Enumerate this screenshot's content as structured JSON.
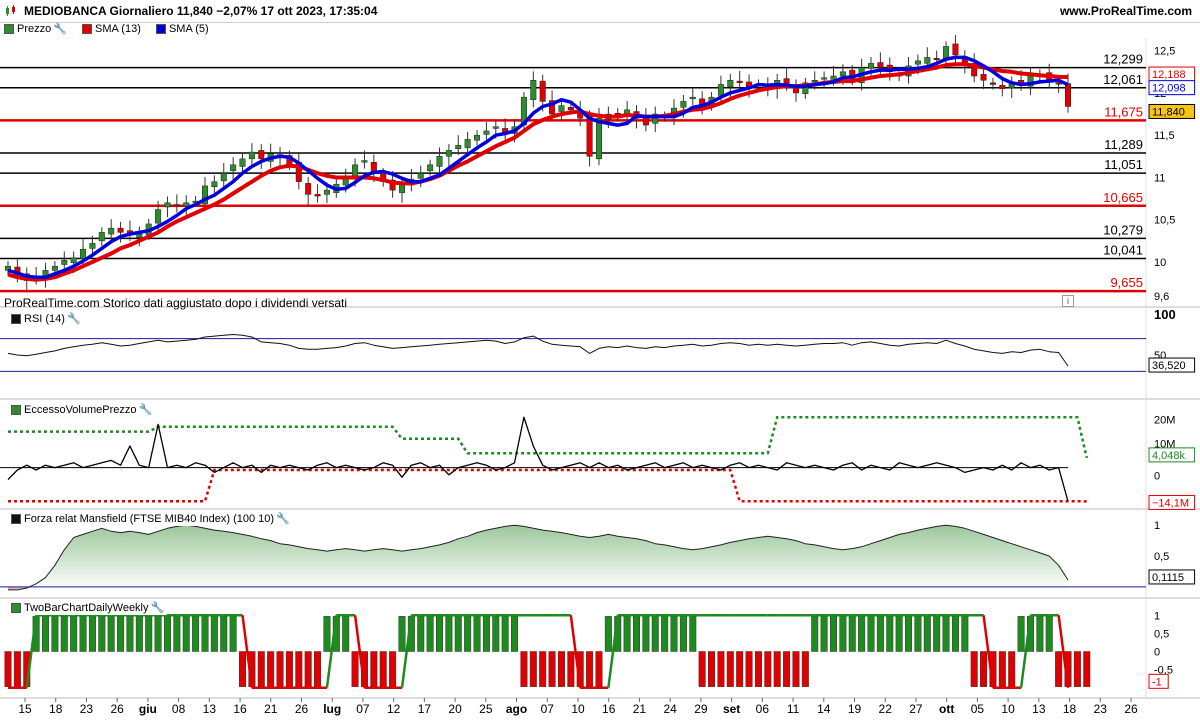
{
  "header": {
    "title": "MEDIOBANCA Giornaliero 11,840 −2,07% 17 ott 2023, 17:35:04",
    "site": "www.ProRealTime.com"
  },
  "price_panel": {
    "legend": [
      {
        "label": "Prezzo",
        "color": "#2e8b2e"
      },
      {
        "label": "SMA (13)",
        "color": "#e00000"
      },
      {
        "label": "SMA (5)",
        "color": "#0000dd"
      }
    ],
    "footer_note": "ProRealTime.com  Storico dati aggiustato dopo i dividendi versati",
    "info_icon": "i"
  },
  "panels": {
    "rsi": {
      "label": "RSI (14)",
      "value_tag": "36,520",
      "ticks": [
        "100",
        "50"
      ]
    },
    "volume": {
      "label": "EccessoVolumePrezzo",
      "tags": [
        "4,048k",
        "0",
        "−14,1M"
      ],
      "ticks": [
        "20M",
        "10M",
        "0"
      ]
    },
    "mansfield": {
      "label": "Forza relat Mansfield (FTSE MIB40 Index) (100 10)",
      "value_tag": "0,1115",
      "ticks": [
        "1",
        "0,5",
        "0"
      ]
    },
    "twobar": {
      "label": "TwoBarChartDailyWeekly",
      "value_tag": "-1",
      "ticks": [
        "1",
        "0,5",
        "0",
        "-0,5"
      ]
    }
  },
  "x_axis": {
    "labels": [
      "15",
      "18",
      "23",
      "26",
      "giu",
      "08",
      "13",
      "16",
      "21",
      "26",
      "lug",
      "07",
      "12",
      "17",
      "20",
      "25",
      "ago",
      "07",
      "10",
      "16",
      "21",
      "24",
      "29",
      "set",
      "06",
      "11",
      "14",
      "19",
      "22",
      "27",
      "ott",
      "05",
      "10",
      "13",
      "18",
      "23",
      "26"
    ],
    "bold": [
      "giu",
      "lug",
      "ago",
      "set",
      "ott"
    ]
  },
  "chart_data": [
    {
      "type": "candlestick",
      "title": "MEDIOBANCA Giornaliero",
      "ylim": [
        9.55,
        12.65
      ],
      "y_ticks": [
        "12,5",
        "12",
        "11,5",
        "11",
        "10,5",
        "10",
        "9,6"
      ],
      "price_tags": [
        {
          "label": "12,188",
          "series": "SMA (13)",
          "color": "#e00000"
        },
        {
          "label": "12,098",
          "series": "SMA (5)",
          "color": "#0000dd"
        },
        {
          "label": "11,840",
          "series": "Prezzo",
          "color": "#f5c518"
        }
      ],
      "levels": [
        {
          "value": 12.299,
          "label": "12,299",
          "color": "#000000"
        },
        {
          "value": 12.061,
          "label": "12,061",
          "color": "#000000"
        },
        {
          "value": 11.675,
          "label": "11,675",
          "color": "#e00000"
        },
        {
          "value": 11.289,
          "label": "11,289",
          "color": "#000000"
        },
        {
          "value": 11.051,
          "label": "11,051",
          "color": "#000000"
        },
        {
          "value": 10.665,
          "label": "10,665",
          "color": "#e00000"
        },
        {
          "value": 10.279,
          "label": "10,279",
          "color": "#000000"
        },
        {
          "value": 10.041,
          "label": "10,041",
          "color": "#000000"
        },
        {
          "value": 9.655,
          "label": "9,655",
          "color": "#e00000"
        }
      ],
      "close": [
        9.95,
        9.85,
        9.78,
        9.82,
        9.9,
        9.95,
        10.02,
        10.05,
        10.15,
        10.22,
        10.35,
        10.4,
        10.35,
        10.32,
        10.33,
        10.45,
        10.62,
        10.7,
        10.66,
        10.7,
        10.72,
        10.9,
        10.95,
        11.05,
        11.15,
        11.22,
        11.3,
        11.22,
        11.28,
        11.25,
        11.15,
        10.95,
        10.8,
        10.78,
        10.85,
        10.92,
        11.0,
        11.15,
        11.2,
        11.05,
        10.95,
        10.85,
        10.92,
        10.98,
        11.05,
        11.15,
        11.25,
        11.32,
        11.38,
        11.45,
        11.5,
        11.55,
        11.6,
        11.52,
        11.6,
        11.95,
        12.15,
        11.9,
        11.75,
        11.85,
        11.8,
        11.7,
        11.25,
        11.7,
        11.75,
        11.72,
        11.8,
        11.7,
        11.62,
        11.75,
        11.72,
        11.82,
        11.9,
        11.95,
        11.85,
        11.95,
        12.1,
        12.15,
        12.12,
        12.05,
        12.1,
        12.05,
        12.15,
        12.1,
        12.0,
        12.12,
        12.15,
        12.18,
        12.2,
        12.25,
        12.15,
        12.3,
        12.35,
        12.3,
        12.25,
        12.2,
        12.32,
        12.38,
        12.42,
        12.4,
        12.55,
        12.45,
        12.35,
        12.2,
        12.15,
        12.1,
        12.05,
        12.12,
        12.1,
        12.2,
        12.22,
        12.15,
        12.12,
        11.84
      ],
      "sma13": [
        9.85,
        9.82,
        9.8,
        9.79,
        9.8,
        9.82,
        9.86,
        9.9,
        9.95,
        10.0,
        10.05,
        10.1,
        10.16,
        10.2,
        10.25,
        10.3,
        10.35,
        10.42,
        10.48,
        10.53,
        10.58,
        10.63,
        10.68,
        10.74,
        10.81,
        10.88,
        10.95,
        11.02,
        11.08,
        11.12,
        11.14,
        11.13,
        11.09,
        11.05,
        11.02,
        11.0,
        11.0,
        11.0,
        11.0,
        10.99,
        10.97,
        10.94,
        10.93,
        10.93,
        10.95,
        10.98,
        11.02,
        11.08,
        11.14,
        11.19,
        11.25,
        11.31,
        11.37,
        11.42,
        11.47,
        11.55,
        11.63,
        11.68,
        11.72,
        11.75,
        11.77,
        11.78,
        11.75,
        11.73,
        11.72,
        11.72,
        11.74,
        11.73,
        11.72,
        11.72,
        11.73,
        11.75,
        11.78,
        11.8,
        11.81,
        11.84,
        11.88,
        11.93,
        11.97,
        12.0,
        12.03,
        12.05,
        12.07,
        12.08,
        12.08,
        12.09,
        12.1,
        12.12,
        12.13,
        12.14,
        12.14,
        12.16,
        12.18,
        12.2,
        12.21,
        12.22,
        12.24,
        12.26,
        12.28,
        12.3,
        12.33,
        12.34,
        12.34,
        12.32,
        12.3,
        12.28,
        12.26,
        12.25,
        12.23,
        12.22,
        12.21,
        12.2,
        12.19,
        12.188
      ],
      "sma5": [
        9.9,
        9.87,
        9.83,
        9.82,
        9.82,
        9.86,
        9.9,
        9.95,
        10.01,
        10.08,
        10.16,
        10.24,
        10.3,
        10.33,
        10.35,
        10.37,
        10.42,
        10.48,
        10.55,
        10.63,
        10.68,
        10.74,
        10.79,
        10.87,
        10.95,
        11.05,
        11.13,
        11.19,
        11.23,
        11.25,
        11.24,
        11.17,
        11.08,
        10.99,
        10.91,
        10.86,
        10.87,
        10.94,
        11.02,
        11.06,
        11.07,
        11.04,
        10.99,
        10.95,
        10.95,
        10.99,
        11.03,
        11.11,
        11.19,
        11.27,
        11.35,
        11.42,
        11.5,
        11.52,
        11.55,
        11.64,
        11.76,
        11.84,
        11.87,
        11.92,
        11.89,
        11.8,
        11.7,
        11.66,
        11.64,
        11.62,
        11.64,
        11.73,
        11.72,
        11.72,
        11.72,
        11.72,
        11.76,
        11.83,
        11.85,
        11.89,
        11.95,
        12.0,
        12.03,
        12.06,
        12.1,
        12.09,
        12.1,
        12.09,
        12.08,
        12.08,
        12.1,
        12.11,
        12.13,
        12.18,
        12.19,
        12.22,
        12.25,
        12.27,
        12.27,
        12.28,
        12.28,
        12.29,
        12.31,
        12.35,
        12.4,
        12.42,
        12.42,
        12.38,
        12.32,
        12.25,
        12.17,
        12.12,
        12.1,
        12.11,
        12.13,
        12.14,
        12.15,
        12.098
      ]
    },
    {
      "type": "line",
      "title": "RSI (14)",
      "ylim": [
        0,
        100
      ],
      "bands": [
        70,
        30
      ],
      "values": [
        52,
        50,
        49,
        51,
        53,
        55,
        58,
        60,
        62,
        63,
        65,
        63,
        61,
        62,
        64,
        66,
        68,
        66,
        67,
        68,
        69,
        72,
        73,
        74,
        75,
        74,
        72,
        66,
        65,
        64,
        62,
        58,
        57,
        57,
        58,
        59,
        61,
        64,
        65,
        62,
        60,
        58,
        59,
        60,
        61,
        62,
        63,
        64,
        65,
        66,
        67,
        68,
        67,
        64,
        66,
        71,
        73,
        67,
        63,
        62,
        61,
        60,
        52,
        58,
        60,
        59,
        61,
        59,
        58,
        60,
        59,
        61,
        62,
        63,
        61,
        62,
        64,
        65,
        64,
        62,
        63,
        62,
        63,
        62,
        61,
        62,
        63,
        64,
        64,
        65,
        62,
        65,
        66,
        64,
        62,
        61,
        63,
        64,
        65,
        64,
        68,
        64,
        61,
        57,
        55,
        53,
        52,
        54,
        53,
        56,
        57,
        54,
        53,
        36.52
      ]
    },
    {
      "type": "line",
      "title": "EccessoVolumePrezzo",
      "ylim": [
        -16,
        24
      ],
      "values": [
        -5,
        -1,
        1,
        -1,
        1,
        0,
        1,
        2,
        0,
        1,
        2,
        3,
        1,
        9,
        1,
        0,
        18,
        0,
        1,
        0,
        2,
        1,
        -2,
        0,
        2,
        0,
        1,
        -2,
        1,
        0,
        1,
        0,
        -1,
        1,
        2,
        0,
        1,
        0,
        -1,
        0,
        2,
        1,
        -4,
        1,
        2,
        0,
        1,
        -3,
        0,
        1,
        2,
        1,
        -1,
        0,
        2,
        21,
        9,
        1,
        -1,
        0,
        1,
        2,
        0,
        2,
        0,
        1,
        -1,
        0,
        1,
        2,
        0,
        1,
        2,
        0,
        1,
        0,
        -1,
        1,
        2,
        0,
        1,
        0,
        -1,
        2,
        1,
        0,
        1,
        0,
        -1,
        1,
        2,
        -1,
        1,
        0,
        -1,
        2,
        1,
        0,
        1,
        2,
        1,
        0,
        -2,
        -1,
        0,
        -1,
        1,
        -1,
        2,
        0,
        1,
        -1,
        0,
        -14.1
      ],
      "upper_band": [
        15,
        15,
        15,
        15,
        15,
        15,
        15,
        15,
        15,
        15,
        15,
        15,
        15,
        15,
        15,
        15,
        17,
        17,
        17,
        17,
        17,
        17,
        17,
        17,
        17,
        17,
        17,
        17,
        17,
        17,
        17,
        17,
        17,
        17,
        17,
        17,
        17,
        17,
        17,
        17,
        17,
        17,
        12,
        12,
        12,
        12,
        12,
        12,
        12,
        6,
        6,
        6,
        6,
        6,
        6,
        6,
        6,
        6,
        6,
        6,
        6,
        6,
        6,
        6,
        6,
        6,
        6,
        6,
        6,
        6,
        6,
        6,
        6,
        6,
        6,
        6,
        6,
        6,
        6,
        6,
        6,
        6,
        21,
        21,
        21,
        21,
        21,
        21,
        21,
        21,
        21,
        21,
        21,
        21,
        21,
        21,
        21,
        21,
        21,
        21,
        21,
        21,
        21,
        21,
        21,
        21,
        21,
        21,
        21,
        21,
        21,
        21,
        21,
        21,
        21,
        4.048
      ],
      "lower_band": [
        -14,
        -14,
        -14,
        -14,
        -14,
        -14,
        -14,
        -14,
        -14,
        -14,
        -14,
        -14,
        -14,
        -14,
        -14,
        -14,
        -14,
        -14,
        -14,
        -14,
        -14,
        -14,
        -1,
        -1,
        -1,
        -1,
        -1,
        -1,
        -1,
        -1,
        -1,
        -1,
        -1,
        -1,
        -1,
        -1,
        -1,
        -1,
        -1,
        -1,
        -1,
        -1,
        -1,
        -1,
        -1,
        -1,
        -1,
        -1,
        -1,
        -1,
        -1,
        -1,
        -1,
        -1,
        -1,
        -1,
        -1,
        -1,
        -1,
        -1,
        -1,
        -1,
        -1,
        -1,
        -1,
        -1,
        -1,
        -1,
        -1,
        -1,
        -1,
        -1,
        -1,
        -1,
        -1,
        -1,
        -1,
        -1,
        -14,
        -14,
        -14,
        -14,
        -14,
        -14,
        -14,
        -14,
        -14,
        -14,
        -14,
        -14,
        -14,
        -14,
        -14,
        -14,
        -14,
        -14,
        -14,
        -14,
        -14,
        -14,
        -14,
        -14,
        -14,
        -14,
        -14,
        -14,
        -14,
        -14,
        -14,
        -14,
        -14,
        -14,
        -14,
        -14,
        -14,
        -14.1
      ]
    },
    {
      "type": "area",
      "title": "Forza relat Mansfield (FTSE MIB40 Index)",
      "ylim": [
        -0.1,
        1.1
      ],
      "values": [
        -0.05,
        -0.05,
        -0.02,
        0.05,
        0.15,
        0.35,
        0.6,
        0.8,
        0.85,
        0.9,
        0.95,
        0.9,
        0.88,
        0.9,
        0.88,
        0.85,
        0.9,
        0.95,
        0.98,
        1.0,
        0.98,
        0.95,
        0.92,
        0.9,
        0.88,
        0.85,
        0.82,
        0.78,
        0.75,
        0.7,
        0.68,
        0.65,
        0.62,
        0.6,
        0.58,
        0.6,
        0.62,
        0.6,
        0.58,
        0.6,
        0.62,
        0.6,
        0.58,
        0.6,
        0.62,
        0.65,
        0.68,
        0.72,
        0.78,
        0.82,
        0.88,
        0.92,
        0.95,
        0.98,
        1.0,
        0.98,
        0.95,
        0.92,
        0.9,
        0.88,
        0.85,
        0.82,
        0.8,
        0.82,
        0.85,
        0.82,
        0.8,
        0.78,
        0.75,
        0.7,
        0.68,
        0.65,
        0.62,
        0.6,
        0.62,
        0.65,
        0.68,
        0.72,
        0.75,
        0.78,
        0.8,
        0.82,
        0.8,
        0.78,
        0.75,
        0.7,
        0.68,
        0.65,
        0.62,
        0.6,
        0.62,
        0.65,
        0.7,
        0.75,
        0.8,
        0.85,
        0.88,
        0.92,
        0.95,
        0.98,
        1.0,
        0.98,
        0.95,
        0.9,
        0.85,
        0.8,
        0.75,
        0.7,
        0.65,
        0.6,
        0.55,
        0.5,
        0.35,
        0.1115
      ]
    },
    {
      "type": "bar",
      "title": "TwoBarChartDailyWeekly",
      "ylim": [
        -1.2,
        1.2
      ],
      "values": [
        -1,
        -1,
        -1,
        1,
        1,
        1,
        1,
        1,
        1,
        1,
        1,
        1,
        1,
        1,
        1,
        1,
        1,
        1,
        1,
        1,
        1,
        1,
        1,
        1,
        1,
        -1,
        -1,
        -1,
        -1,
        -1,
        -1,
        -1,
        -1,
        -1,
        1,
        1,
        1,
        -1,
        -1,
        -1,
        -1,
        -1,
        1,
        1,
        1,
        1,
        1,
        1,
        1,
        1,
        1,
        1,
        1,
        1,
        1,
        -1,
        -1,
        -1,
        -1,
        -1,
        -1,
        -1,
        -1,
        -1,
        1,
        1,
        1,
        1,
        1,
        1,
        1,
        1,
        1,
        1,
        -1,
        -1,
        -1,
        -1,
        -1,
        -1,
        -1,
        -1,
        -1,
        -1,
        -1,
        -1,
        1,
        1,
        1,
        1,
        1,
        1,
        1,
        1,
        1,
        1,
        1,
        1,
        1,
        1,
        1,
        1,
        1,
        -1,
        -1,
        -1,
        -1,
        -1,
        1,
        1,
        1,
        1,
        -1,
        -1,
        -1,
        -1
      ],
      "weekly": [
        -1,
        -1,
        -1,
        1,
        1,
        1,
        1,
        1,
        1,
        1,
        1,
        1,
        1,
        1,
        1,
        1,
        1,
        1,
        1,
        1,
        1,
        1,
        1,
        1,
        1,
        1,
        -1,
        -1,
        -1,
        -1,
        -1,
        -1,
        -1,
        -1,
        -1,
        1,
        1,
        1,
        -1,
        -1,
        -1,
        -1,
        -1,
        1,
        1,
        1,
        1,
        1,
        1,
        1,
        1,
        1,
        1,
        1,
        1,
        1,
        1,
        1,
        1,
        1,
        1,
        -1,
        -1,
        -1,
        -1,
        1,
        1,
        1,
        1,
        1,
        1,
        1,
        1,
        1,
        1,
        1,
        1,
        1,
        1,
        1,
        1,
        1,
        1,
        1,
        1,
        1,
        1,
        1,
        1,
        1,
        1,
        1,
        1,
        1,
        1,
        1,
        1,
        1,
        1,
        1,
        1,
        1,
        1,
        1,
        1,
        -1,
        -1,
        -1,
        -1,
        1,
        1,
        1,
        1,
        -1,
        -1,
        -1,
        -1
      ]
    }
  ]
}
